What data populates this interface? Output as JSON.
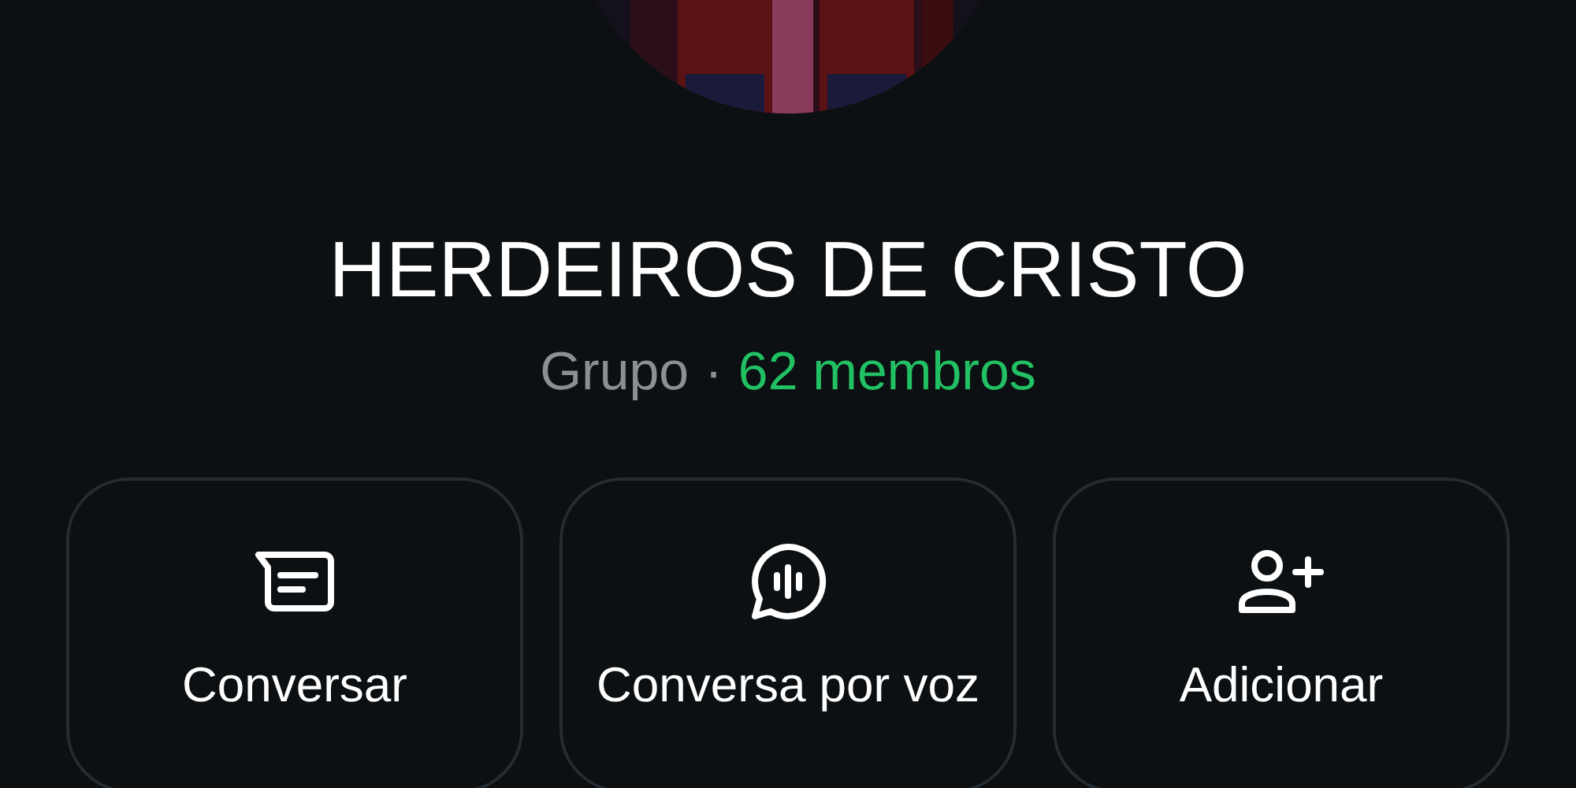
{
  "group": {
    "name": "HERDEIROS DE CRISTO",
    "type": "Grupo",
    "separator": "·",
    "members": "62 membros"
  },
  "actions": [
    {
      "label": "Conversar",
      "kind": "message"
    },
    {
      "label": "Conversa por voz",
      "kind": "voice"
    },
    {
      "label": "Adicionar",
      "kind": "add-person"
    }
  ]
}
